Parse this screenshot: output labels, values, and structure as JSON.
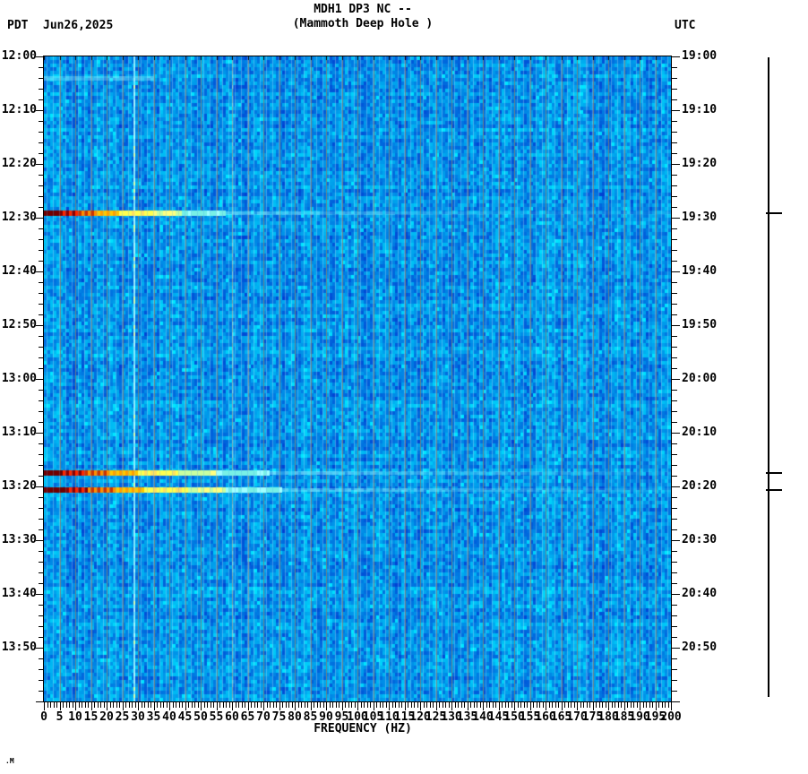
{
  "header": {
    "timezone_left": "PDT",
    "date": "Jun26,2025",
    "title_line1": "MDH1 DP3 NC --",
    "title_line2": "(Mammoth Deep Hole )",
    "timezone_right": "UTC"
  },
  "x_axis_title": "FREQUENCY (HZ)",
  "corner_mark": ".M",
  "chart_data": {
    "type": "heatmap",
    "subtype": "seismic-spectrogram",
    "station": "MDH1 DP3 NC",
    "station_name": "Mammoth Deep Hole",
    "date": "Jun26,2025",
    "title": "MDH1 DP3 NC -- (Mammoth Deep Hole )",
    "xlabel": "FREQUENCY (HZ)",
    "x_range_hz": [
      0,
      200
    ],
    "x_major_tick_hz": 5,
    "x_minor_tick_hz": 1,
    "x_tick_labels": [
      "0",
      "5",
      "10",
      "15",
      "20",
      "25",
      "30",
      "35",
      "40",
      "45",
      "50",
      "55",
      "60",
      "65",
      "70",
      "75",
      "80",
      "85",
      "90",
      "95",
      "100",
      "105",
      "110",
      "115",
      "120",
      "125",
      "130",
      "135",
      "140",
      "145",
      "150",
      "155",
      "160",
      "165",
      "170",
      "175",
      "180",
      "185",
      "190",
      "195",
      "200"
    ],
    "time_axis_left": {
      "timezone": "PDT",
      "start": "12:00",
      "end": "14:00",
      "major_tick_min": 10,
      "minor_tick_min": 2,
      "tick_labels": [
        "12:00",
        "12:10",
        "12:20",
        "12:30",
        "12:40",
        "12:50",
        "13:00",
        "13:10",
        "13:20",
        "13:30",
        "13:40",
        "13:50"
      ]
    },
    "time_axis_right": {
      "timezone": "UTC",
      "start": "19:00",
      "end": "21:00",
      "major_tick_min": 10,
      "minor_tick_min": 2,
      "tick_labels": [
        "19:00",
        "19:10",
        "19:20",
        "19:30",
        "19:40",
        "19:50",
        "20:00",
        "20:10",
        "20:20",
        "20:30",
        "20:40",
        "20:50"
      ]
    },
    "grid_lines_every_hz": 5,
    "grid_line_color": "#808076",
    "background_noise_colors": [
      "#0046d2",
      "#0078ec",
      "#00a6ff",
      "#00d2ff"
    ],
    "event_gradient": [
      "#700000",
      "#8b0000",
      "#ff2800",
      "#ff9000",
      "#ffc800",
      "#ffff50",
      "#c8ffa0",
      "#78f0e6",
      "#82f0ff"
    ],
    "persistent_vertical_lines_hz": [
      28.5,
      60,
      65,
      173
    ],
    "events": [
      {
        "time_pdt": "12:29",
        "time_utc": "19:29",
        "minutes_after_start": 29.2,
        "strength": 0.8
      },
      {
        "time_pdt": "13:17",
        "time_utc": "20:17",
        "minutes_after_start": 77.5,
        "strength": 1.0
      },
      {
        "time_pdt": "13:20",
        "time_utc": "20:20",
        "minutes_after_start": 80.7,
        "strength": 1.05
      }
    ],
    "faint_band": {
      "time_pdt": "12:04",
      "minutes_after_start": 4,
      "max_hz": 35
    },
    "amplitude_bar": {
      "marker_minutes": [
        29.2,
        77.5,
        80.7
      ]
    }
  }
}
